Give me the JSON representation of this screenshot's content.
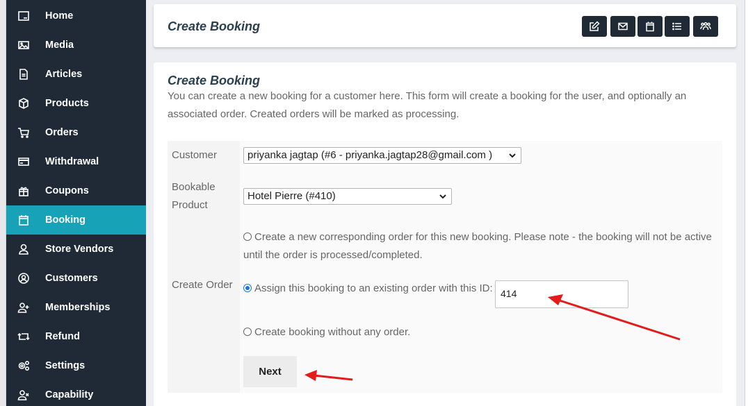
{
  "sidebar": {
    "items": [
      {
        "label": "Home",
        "icon": "home-icon",
        "active": false
      },
      {
        "label": "Media",
        "icon": "image-icon",
        "active": false
      },
      {
        "label": "Articles",
        "icon": "document-icon",
        "active": false
      },
      {
        "label": "Products",
        "icon": "box-icon",
        "active": false
      },
      {
        "label": "Orders",
        "icon": "cart-icon",
        "active": false
      },
      {
        "label": "Withdrawal",
        "icon": "credit-card-icon",
        "active": false
      },
      {
        "label": "Coupons",
        "icon": "gift-icon",
        "active": false
      },
      {
        "label": "Booking",
        "icon": "calendar-icon",
        "active": true
      },
      {
        "label": "Store Vendors",
        "icon": "user-icon",
        "active": false
      },
      {
        "label": "Customers",
        "icon": "user-circle-icon",
        "active": false
      },
      {
        "label": "Memberships",
        "icon": "user-plus-icon",
        "active": false
      },
      {
        "label": "Refund",
        "icon": "refund-icon",
        "active": false
      },
      {
        "label": "Settings",
        "icon": "gears-icon",
        "active": false
      },
      {
        "label": "Capability",
        "icon": "user-x-icon",
        "active": false
      }
    ]
  },
  "header": {
    "title": "Create Booking",
    "buttons": [
      {
        "name": "edit-button",
        "icon": "pencil-square-icon"
      },
      {
        "name": "mail-button",
        "icon": "envelope-icon"
      },
      {
        "name": "calendar-button",
        "icon": "calendar-icon"
      },
      {
        "name": "list-button",
        "icon": "list-icon"
      },
      {
        "name": "users-button",
        "icon": "users-icon"
      }
    ]
  },
  "main": {
    "title": "Create Booking",
    "description": "You can create a new booking for a customer here. This form will create a booking for the user, and optionally an associated order. Created orders will be marked as processing.",
    "form": {
      "customer_label": "Customer",
      "customer_value": "priyanka jagtap (#6 - priyanka.jagtap28@gmail.com )",
      "product_label_line1": "Bookable",
      "product_label_line2": "Product",
      "product_value": "Hotel Pierre (#410)",
      "create_order_label": "Create Order",
      "options": [
        {
          "label": "Create a new corresponding order for this new booking. Please note - the booking will not be active until the order is processed/completed.",
          "checked": false
        },
        {
          "label": "Assign this booking to an existing order with this ID:",
          "checked": true
        },
        {
          "label": "Create booking without any order.",
          "checked": false
        }
      ],
      "order_id_value": "414",
      "next_label": "Next"
    }
  },
  "colors": {
    "sidebar_bg": "#1f2a36",
    "active_item": "#17a2b8",
    "annotation_arrow": "#e31b1b"
  }
}
